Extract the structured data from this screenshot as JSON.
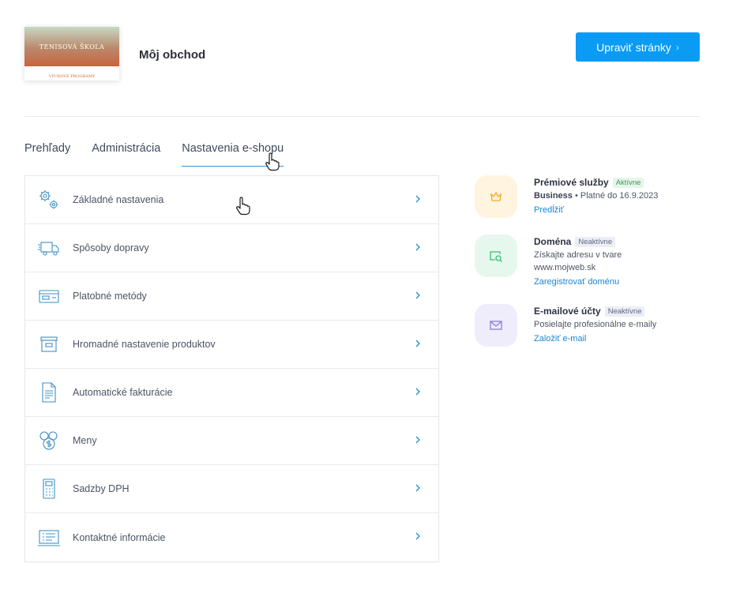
{
  "header": {
    "thumbnail_title": "TENISOVÁ ŠKOLA",
    "thumbnail_subtitle": "VÝUKOVÉ PROGRAMY",
    "shop_name": "Môj obchod",
    "edit_button": "Upraviť stránky",
    "edit_chevron": "›"
  },
  "tabs": [
    {
      "label": "Prehľady",
      "active": false
    },
    {
      "label": "Administrácia",
      "active": false
    },
    {
      "label": "Nastavenia e-shopu",
      "active": true
    }
  ],
  "settings": [
    {
      "label": "Základné nastavenia",
      "icon": "gears-icon"
    },
    {
      "label": "Spôsoby dopravy",
      "icon": "truck-icon"
    },
    {
      "label": "Platobné metódy",
      "icon": "card-icon"
    },
    {
      "label": "Hromadné nastavenie produktov",
      "icon": "box-icon"
    },
    {
      "label": "Automatické fakturácie",
      "icon": "invoice-icon"
    },
    {
      "label": "Meny",
      "icon": "coins-icon"
    },
    {
      "label": "Sadzby DPH",
      "icon": "calculator-icon"
    },
    {
      "label": "Kontaktné informácie",
      "icon": "laptop-icon"
    }
  ],
  "services": [
    {
      "title": "Prémiové služby",
      "badge": "Aktívne",
      "plan": "Business",
      "detail": "• Platné do 16.9.2023",
      "link": "Predĺžiť",
      "icon": "crown-icon",
      "icon_bg": "#fff4df",
      "icon_color": "#f3a928"
    },
    {
      "title": "Doména",
      "badge": "Neaktívne",
      "line1": "Získajte adresu v tvare",
      "line2": "www.mojweb.sk",
      "link": "Zaregistrovať doménu",
      "icon": "domain-search-icon",
      "icon_bg": "#e6f7ee",
      "icon_color": "#34c07a"
    },
    {
      "title": "E-mailové účty",
      "badge": "Neaktívne",
      "line1": "Posielajte profesionálne e-maily",
      "link": "Založiť e-mail",
      "icon": "mail-icon",
      "icon_bg": "#efecfb",
      "icon_color": "#8e7be0"
    }
  ],
  "colors": {
    "accent": "#0a9bf5",
    "link": "#1a86d4",
    "icon_stroke": "#3f8fc4"
  }
}
